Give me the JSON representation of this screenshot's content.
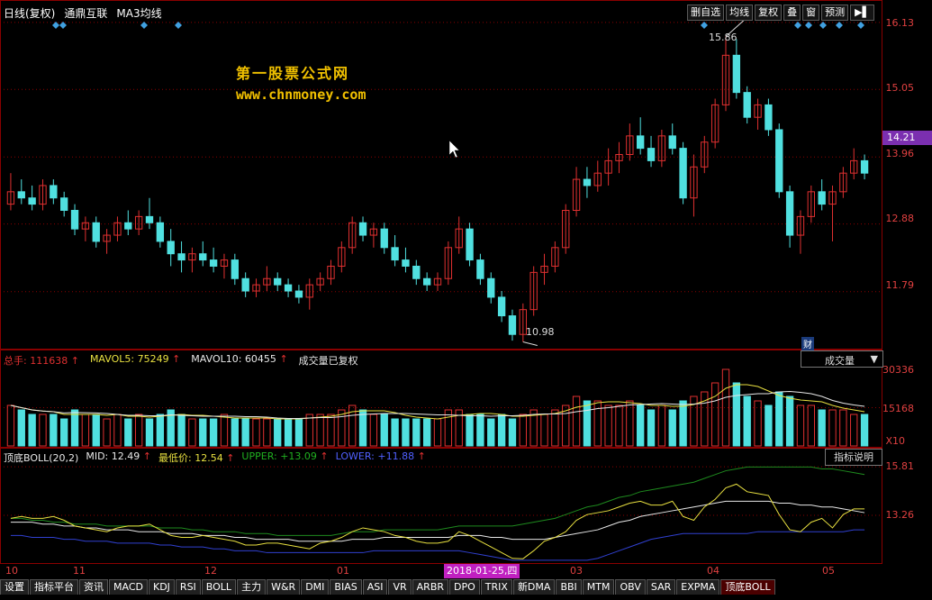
{
  "header": {
    "chart_type": "日线(复权)",
    "stock_name": "通鼎互联",
    "indicator": "MA3均线"
  },
  "toolbar": {
    "buttons": [
      "删自选",
      "均线",
      "复权",
      "叠",
      "窗",
      "预测"
    ],
    "arrow_label": "▶▌"
  },
  "watermark": {
    "line1": "第一股票公式网",
    "line2": "www.chnmoney.com"
  },
  "price_panel": {
    "axis_labels": [
      "16.13",
      "15.05",
      "13.96",
      "12.88",
      "11.79"
    ],
    "current_price": "14.21",
    "high_label": "15.86",
    "low_label": "10.98",
    "badge": "财"
  },
  "volume_panel": {
    "total_label": "总手:",
    "total_value": "111638",
    "mavol5_label": "MAVOL5:",
    "mavol5_value": "75249",
    "mavol10_label": "MAVOL10:",
    "mavol10_value": "60455",
    "note": "成交量已复权",
    "axis_labels": [
      "30336",
      "15168",
      "X10"
    ],
    "dropdown_label": "成交量",
    "dropdown_caret": "▼"
  },
  "boll_panel": {
    "name": "顶底BOLL(20,2)",
    "mid_label": "MID:",
    "mid_value": "12.49",
    "low_label": "最低价:",
    "low_value": "12.54",
    "upper_label": "UPPER:",
    "upper_value": "+13.09",
    "lower_label": "LOWER:",
    "lower_value": "+11.88",
    "axis_labels": [
      "15.81",
      "13.26"
    ],
    "help_label": "指标说明"
  },
  "time_axis": {
    "labels": [
      "10",
      "11",
      "12",
      "01",
      "03",
      "04",
      "05"
    ],
    "cursor_date": "2018-01-25,四"
  },
  "tabs": [
    "设置",
    "指标平台",
    "资讯",
    "MACD",
    "KDJ",
    "RSI",
    "BOLL",
    "主力",
    "W&R",
    "DMI",
    "BIAS",
    "ASI",
    "VR",
    "ARBR",
    "DPO",
    "TRIX",
    "新DMA",
    "BBI",
    "MTM",
    "OBV",
    "SAR",
    "EXPMA",
    "顶底BOLL"
  ],
  "active_tab": "顶底BOLL",
  "colors": {
    "up": "#e03030",
    "down": "#50e0e0",
    "grid": "#8a0000",
    "axis_text": "#e04040",
    "upper_line": "#1e8a1e",
    "lower_line": "#3040d0",
    "mid_line": "#e8e8e8",
    "low_line": "#e8e040"
  },
  "chart_data": {
    "type": "candlestick",
    "price_range": [
      10.9,
      16.2
    ],
    "candles": [
      [
        13.2,
        13.7,
        13.1,
        13.4
      ],
      [
        13.4,
        13.6,
        13.2,
        13.3
      ],
      [
        13.3,
        13.5,
        13.1,
        13.2
      ],
      [
        13.2,
        13.6,
        13.1,
        13.5
      ],
      [
        13.5,
        13.6,
        13.2,
        13.3
      ],
      [
        13.3,
        13.4,
        13.0,
        13.1
      ],
      [
        13.1,
        13.2,
        12.7,
        12.8
      ],
      [
        12.8,
        13.0,
        12.6,
        12.9
      ],
      [
        12.9,
        13.0,
        12.5,
        12.6
      ],
      [
        12.6,
        12.8,
        12.4,
        12.7
      ],
      [
        12.7,
        13.0,
        12.6,
        12.9
      ],
      [
        12.9,
        13.1,
        12.7,
        12.8
      ],
      [
        12.8,
        13.1,
        12.7,
        13.0
      ],
      [
        13.0,
        13.3,
        12.8,
        12.9
      ],
      [
        12.9,
        13.0,
        12.5,
        12.6
      ],
      [
        12.6,
        12.8,
        12.2,
        12.4
      ],
      [
        12.4,
        12.6,
        12.1,
        12.3
      ],
      [
        12.3,
        12.5,
        12.1,
        12.4
      ],
      [
        12.4,
        12.6,
        12.2,
        12.3
      ],
      [
        12.3,
        12.5,
        12.1,
        12.2
      ],
      [
        12.2,
        12.4,
        12.0,
        12.3
      ],
      [
        12.3,
        12.4,
        11.9,
        12.0
      ],
      [
        12.0,
        12.1,
        11.7,
        11.8
      ],
      [
        11.8,
        12.0,
        11.7,
        11.9
      ],
      [
        11.9,
        12.2,
        11.8,
        12.0
      ],
      [
        12.0,
        12.1,
        11.8,
        11.9
      ],
      [
        11.9,
        12.0,
        11.7,
        11.8
      ],
      [
        11.8,
        11.9,
        11.6,
        11.7
      ],
      [
        11.7,
        12.0,
        11.5,
        11.9
      ],
      [
        11.9,
        12.1,
        11.8,
        12.0
      ],
      [
        12.0,
        12.3,
        11.9,
        12.2
      ],
      [
        12.2,
        12.6,
        12.1,
        12.5
      ],
      [
        12.5,
        13.0,
        12.4,
        12.9
      ],
      [
        12.9,
        13.0,
        12.6,
        12.7
      ],
      [
        12.7,
        12.9,
        12.5,
        12.8
      ],
      [
        12.8,
        12.9,
        12.4,
        12.5
      ],
      [
        12.5,
        12.7,
        12.2,
        12.3
      ],
      [
        12.3,
        12.5,
        12.1,
        12.2
      ],
      [
        12.2,
        12.3,
        11.9,
        12.0
      ],
      [
        12.0,
        12.1,
        11.8,
        11.9
      ],
      [
        11.9,
        12.1,
        11.8,
        12.0
      ],
      [
        12.0,
        12.6,
        11.9,
        12.5
      ],
      [
        12.5,
        13.0,
        12.4,
        12.8
      ],
      [
        12.8,
        12.9,
        12.2,
        12.3
      ],
      [
        12.3,
        12.4,
        11.9,
        12.0
      ],
      [
        12.0,
        12.1,
        11.6,
        11.7
      ],
      [
        11.7,
        11.8,
        11.3,
        11.4
      ],
      [
        11.4,
        11.5,
        11.0,
        11.1
      ],
      [
        11.1,
        11.6,
        10.98,
        11.5
      ],
      [
        11.5,
        12.2,
        11.4,
        12.1
      ],
      [
        12.1,
        12.4,
        11.9,
        12.2
      ],
      [
        12.2,
        12.6,
        12.1,
        12.5
      ],
      [
        12.5,
        13.2,
        12.4,
        13.1
      ],
      [
        13.1,
        13.8,
        13.0,
        13.6
      ],
      [
        13.6,
        13.8,
        13.3,
        13.5
      ],
      [
        13.5,
        13.9,
        13.4,
        13.7
      ],
      [
        13.7,
        14.1,
        13.5,
        13.9
      ],
      [
        13.9,
        14.2,
        13.7,
        14.0
      ],
      [
        14.0,
        14.5,
        13.9,
        14.3
      ],
      [
        14.3,
        14.6,
        14.0,
        14.1
      ],
      [
        14.1,
        14.3,
        13.8,
        13.9
      ],
      [
        13.9,
        14.4,
        13.8,
        14.3
      ],
      [
        14.3,
        14.5,
        14.0,
        14.1
      ],
      [
        14.1,
        14.2,
        13.2,
        13.3
      ],
      [
        13.3,
        14.0,
        13.0,
        13.8
      ],
      [
        13.8,
        14.3,
        13.7,
        14.2
      ],
      [
        14.2,
        14.9,
        14.1,
        14.8
      ],
      [
        14.8,
        15.9,
        14.7,
        15.6
      ],
      [
        15.6,
        15.86,
        14.9,
        15.0
      ],
      [
        15.0,
        15.1,
        14.5,
        14.6
      ],
      [
        14.6,
        14.9,
        14.4,
        14.8
      ],
      [
        14.8,
        14.9,
        14.3,
        14.4
      ],
      [
        14.4,
        14.5,
        13.3,
        13.4
      ],
      [
        13.4,
        13.5,
        12.5,
        12.7
      ],
      [
        12.7,
        13.1,
        12.4,
        13.0
      ],
      [
        13.0,
        13.5,
        12.9,
        13.4
      ],
      [
        13.4,
        13.6,
        13.1,
        13.2
      ],
      [
        13.2,
        13.5,
        12.6,
        13.4
      ],
      [
        13.4,
        13.8,
        13.3,
        13.7
      ],
      [
        13.7,
        14.1,
        13.6,
        13.9
      ],
      [
        13.9,
        14.0,
        13.6,
        13.7
      ]
    ],
    "volumes": [
      9,
      8,
      7,
      7,
      7,
      6,
      8,
      7,
      7,
      6,
      7,
      6,
      7,
      6,
      7,
      8,
      7,
      6,
      6,
      6,
      7,
      6,
      6,
      6,
      6,
      6,
      6,
      6,
      7,
      7,
      7,
      8,
      9,
      8,
      7,
      7,
      6,
      6,
      6,
      6,
      6,
      8,
      8,
      7,
      7,
      6,
      7,
      6,
      7,
      8,
      7,
      8,
      9,
      11,
      10,
      10,
      9,
      9,
      10,
      9,
      8,
      9,
      8,
      10,
      11,
      12,
      14,
      17,
      14,
      11,
      10,
      9,
      12,
      11,
      9,
      9,
      8,
      8,
      8,
      7,
      7
    ],
    "boll_upper": [
      13.1,
      13.1,
      13.0,
      13.0,
      12.9,
      12.9,
      12.8,
      12.8,
      12.8,
      12.7,
      12.7,
      12.7,
      12.7,
      12.7,
      12.6,
      12.6,
      12.6,
      12.5,
      12.5,
      12.4,
      12.4,
      12.4,
      12.3,
      12.3,
      12.3,
      12.2,
      12.2,
      12.2,
      12.2,
      12.2,
      12.2,
      12.3,
      12.4,
      12.4,
      12.4,
      12.5,
      12.5,
      12.5,
      12.5,
      12.5,
      12.5,
      12.6,
      12.7,
      12.7,
      12.7,
      12.7,
      12.7,
      12.7,
      12.8,
      12.9,
      13.0,
      13.1,
      13.3,
      13.5,
      13.7,
      13.8,
      14.0,
      14.2,
      14.3,
      14.5,
      14.6,
      14.7,
      14.8,
      14.9,
      15.0,
      15.2,
      15.4,
      15.6,
      15.7,
      15.8,
      15.8,
      15.8,
      15.8,
      15.8,
      15.8,
      15.8,
      15.7,
      15.7,
      15.6,
      15.5,
      15.4
    ],
    "boll_mid": [
      12.9,
      12.9,
      12.9,
      12.8,
      12.8,
      12.7,
      12.7,
      12.6,
      12.6,
      12.5,
      12.5,
      12.5,
      12.4,
      12.4,
      12.4,
      12.3,
      12.3,
      12.3,
      12.2,
      12.2,
      12.2,
      12.1,
      12.1,
      12.0,
      12.0,
      12.0,
      12.0,
      11.9,
      11.9,
      11.9,
      11.9,
      11.9,
      12.0,
      12.0,
      12.0,
      12.1,
      12.1,
      12.1,
      12.1,
      12.1,
      12.1,
      12.1,
      12.2,
      12.2,
      12.2,
      12.1,
      12.1,
      12.0,
      12.0,
      12.0,
      12.0,
      12.1,
      12.2,
      12.3,
      12.4,
      12.5,
      12.7,
      12.9,
      13.0,
      13.2,
      13.3,
      13.4,
      13.5,
      13.6,
      13.7,
      13.8,
      13.9,
      14.0,
      14.0,
      14.0,
      14.0,
      14.0,
      13.9,
      13.9,
      13.8,
      13.8,
      13.7,
      13.7,
      13.6,
      13.5,
      13.4
    ],
    "boll_lower": [
      12.2,
      12.2,
      12.1,
      12.1,
      12.1,
      12.0,
      12.0,
      11.9,
      11.9,
      11.9,
      11.8,
      11.8,
      11.8,
      11.8,
      11.7,
      11.7,
      11.6,
      11.6,
      11.6,
      11.5,
      11.5,
      11.4,
      11.4,
      11.4,
      11.3,
      11.3,
      11.3,
      11.3,
      11.3,
      11.3,
      11.3,
      11.3,
      11.3,
      11.3,
      11.4,
      11.4,
      11.4,
      11.4,
      11.4,
      11.4,
      11.4,
      11.4,
      11.4,
      11.3,
      11.2,
      11.1,
      11.0,
      10.9,
      10.9,
      10.9,
      10.9,
      10.9,
      10.9,
      10.9,
      10.9,
      11.0,
      11.2,
      11.4,
      11.6,
      11.8,
      12.0,
      12.1,
      12.2,
      12.3,
      12.3,
      12.3,
      12.3,
      12.3,
      12.3,
      12.3,
      12.4,
      12.4,
      12.4,
      12.4,
      12.4,
      12.4,
      12.4,
      12.4,
      12.4,
      12.5,
      12.5
    ],
    "boll_range": [
      10.8,
      16.1
    ]
  }
}
